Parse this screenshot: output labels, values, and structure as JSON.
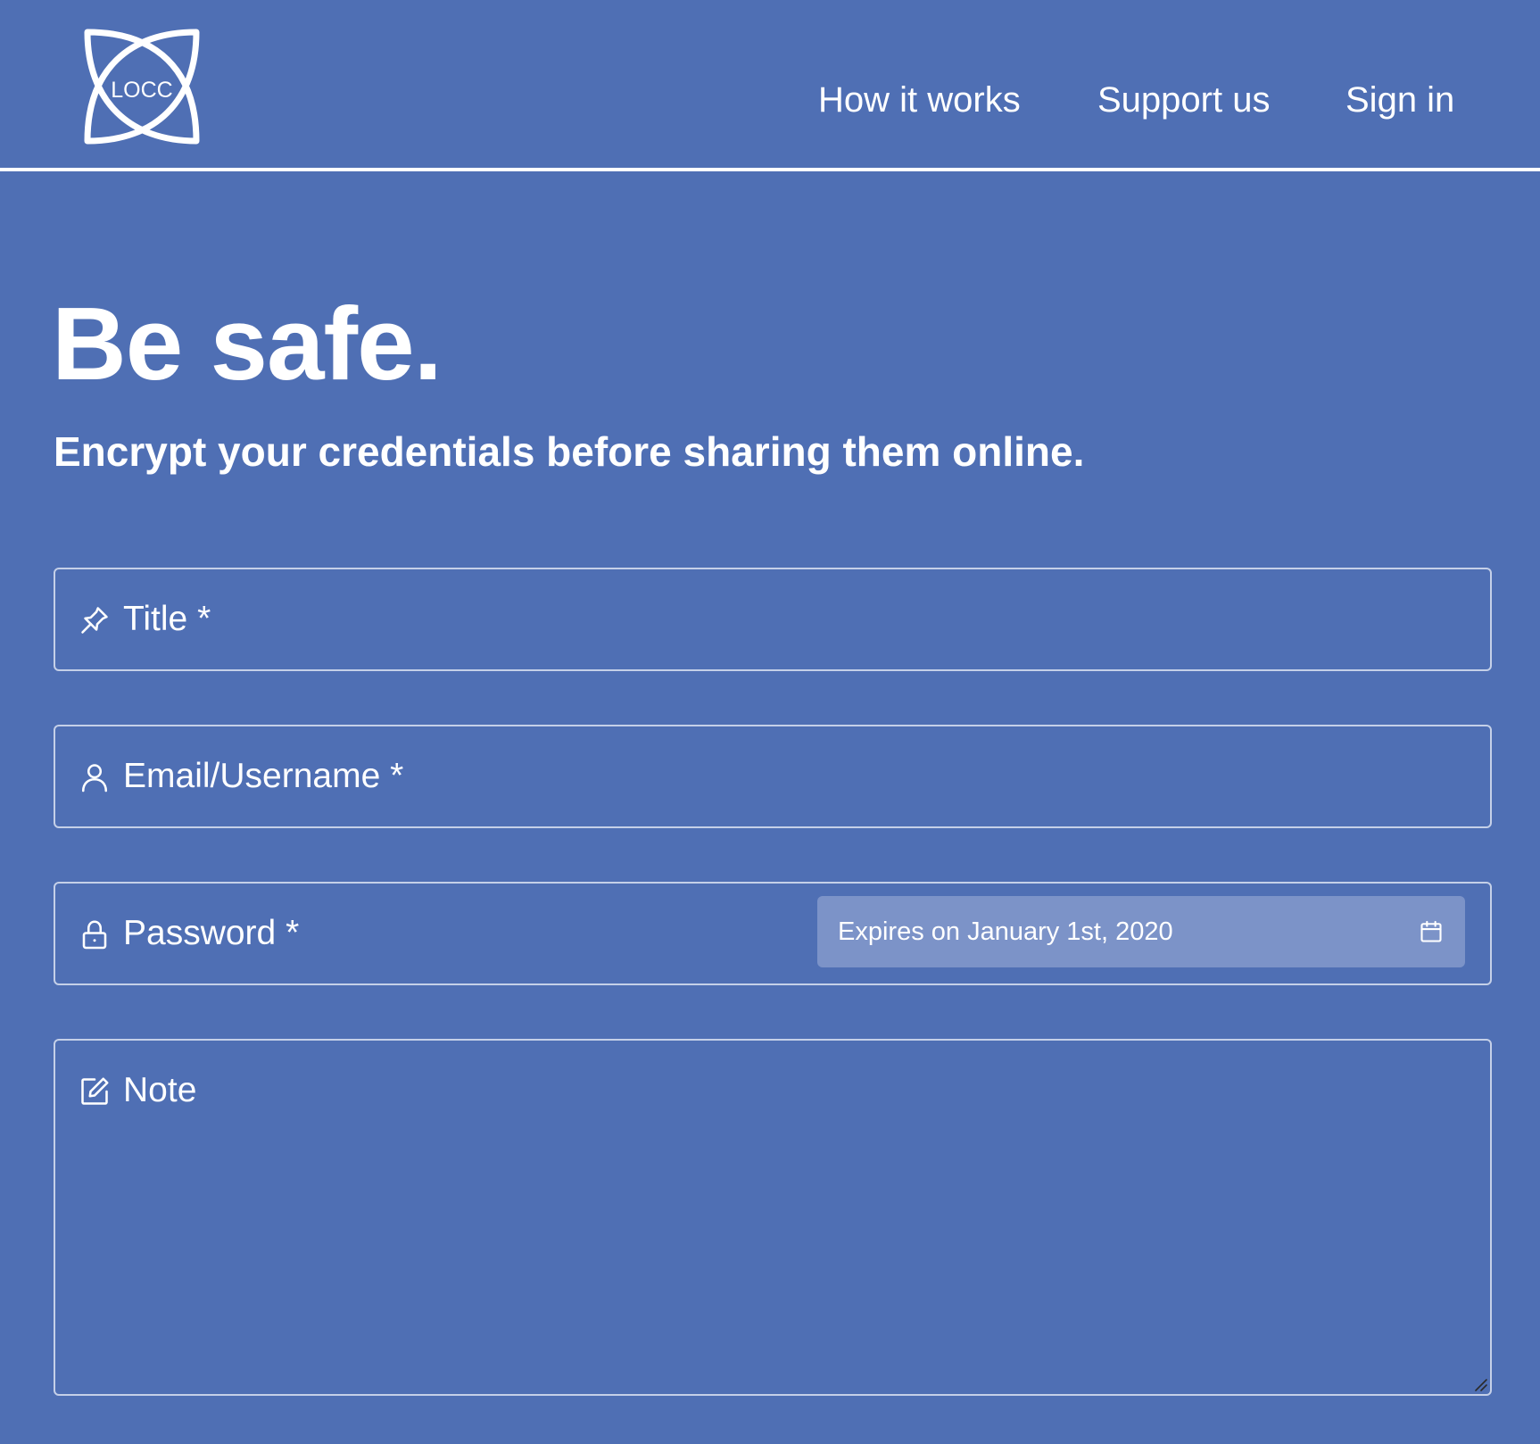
{
  "brand": {
    "logo_text": "LOCC"
  },
  "nav": {
    "items": [
      {
        "label": "How it works"
      },
      {
        "label": "Support us"
      },
      {
        "label": "Sign in"
      }
    ]
  },
  "hero": {
    "title": "Be safe.",
    "subtitle": "Encrypt your credentials before sharing them online."
  },
  "form": {
    "title": {
      "label": "Title *",
      "value": "",
      "icon": "pin-icon"
    },
    "email": {
      "label": "Email/Username *",
      "value": "",
      "icon": "user-icon"
    },
    "password": {
      "label": "Password *",
      "value": "",
      "icon": "lock-icon",
      "expiry": {
        "label": "Expires on January 1st, 2020",
        "icon": "calendar-icon"
      }
    },
    "note": {
      "label": "Note",
      "value": "",
      "icon": "edit-icon"
    }
  },
  "colors": {
    "background": "#4f6fb4",
    "text": "#ffffff",
    "field_border": "#c5d0e8",
    "expiry_background": "#7c93c8"
  }
}
